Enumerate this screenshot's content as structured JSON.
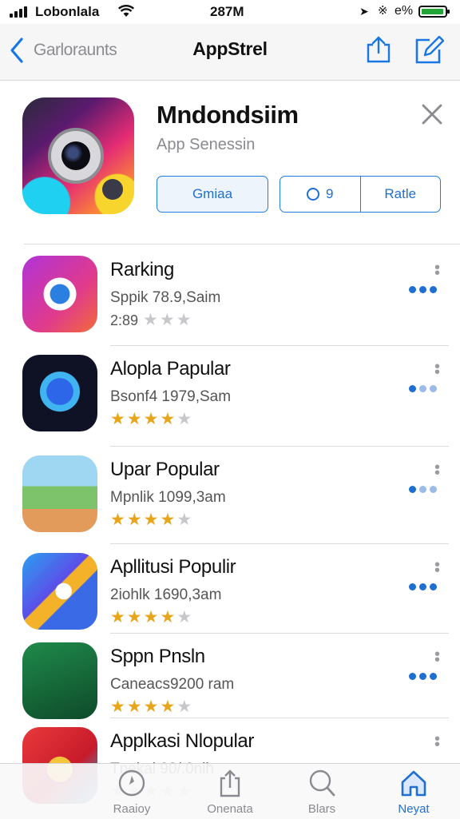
{
  "status": {
    "carrier": "Lobonlala",
    "time": "287M",
    "battery_pct": "e%"
  },
  "nav": {
    "back_label": "Garloraunts",
    "title": "AppStrel"
  },
  "featured": {
    "title": "Mndondsiim",
    "subtitle": "App Senessin",
    "open_label": "Gmiaa",
    "seg_left_label": "9",
    "seg_right_label": "Ratle"
  },
  "list": [
    {
      "name": "Rarking",
      "meta": "Sppik 78.9,Saim",
      "rating_prefix": "2:89",
      "stars_on": 0,
      "dots": "dark"
    },
    {
      "name": "Alopla Papular",
      "meta": "Bsonf4 1979,Sam",
      "rating_prefix": "",
      "stars_on": 4,
      "dots": "mixed"
    },
    {
      "name": "Upar Popular",
      "meta": "Mpnlik 1099,3am",
      "rating_prefix": "",
      "stars_on": 4,
      "dots": "mixed"
    },
    {
      "name": "Apllitusi Populir",
      "meta": "2iohlk 1690,3am",
      "rating_prefix": "",
      "stars_on": 4,
      "dots": "dark"
    },
    {
      "name": "Sppn Pnsln",
      "meta": "Caneacs9200 ram",
      "rating_prefix": "",
      "stars_on": 4,
      "dots": "dark"
    },
    {
      "name": "Applkasi Nlopular",
      "meta": "Tnekal 90/.0nih",
      "rating_prefix": "",
      "stars_on": 0,
      "dots": "none"
    }
  ],
  "tabs": [
    {
      "label": "Raaioy",
      "icon": "compass-icon",
      "active": false
    },
    {
      "label": "Onenata",
      "icon": "share-tray-icon",
      "active": false
    },
    {
      "label": "Blars",
      "icon": "search-icon",
      "active": false
    },
    {
      "label": "Neyat",
      "icon": "home-icon",
      "active": true
    }
  ],
  "colors": {
    "accent": "#1f6fd0",
    "star": "#e7a51c",
    "battery": "#23a437"
  }
}
